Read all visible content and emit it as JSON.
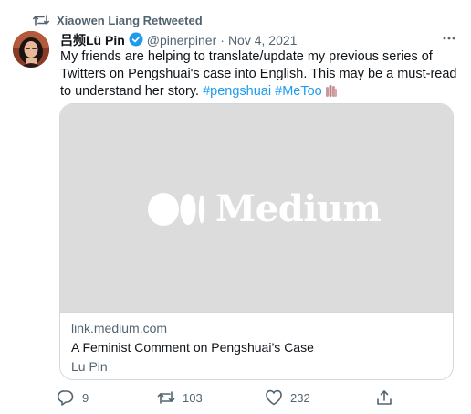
{
  "retweet": {
    "text": "Xiaowen Liang Retweeted",
    "icon": "retweet-icon"
  },
  "tweet": {
    "display_name": "吕频Lü Pin",
    "handle": "@pinerpiner",
    "separator": "·",
    "date": "Nov 4, 2021",
    "more_icon": "more-icon",
    "text_main": "My friends are helping to translate/update my previous series of Twitters on Pengshuai's case into English.  This may be a must-read to understand her story.",
    "hashtags": [
      "#pengshuai",
      "#MeToo"
    ]
  },
  "card": {
    "image_brand": "Medium",
    "domain": "link.medium.com",
    "title": "A Feminist Comment on Pengshuai’s Case",
    "author": "Lu Pin"
  },
  "actions": {
    "replies": "9",
    "retweets": "103",
    "likes": "232"
  },
  "colors": {
    "accent": "#1d9bf0",
    "text_secondary": "#536471",
    "card_image_bg": "#dcdcdc"
  }
}
